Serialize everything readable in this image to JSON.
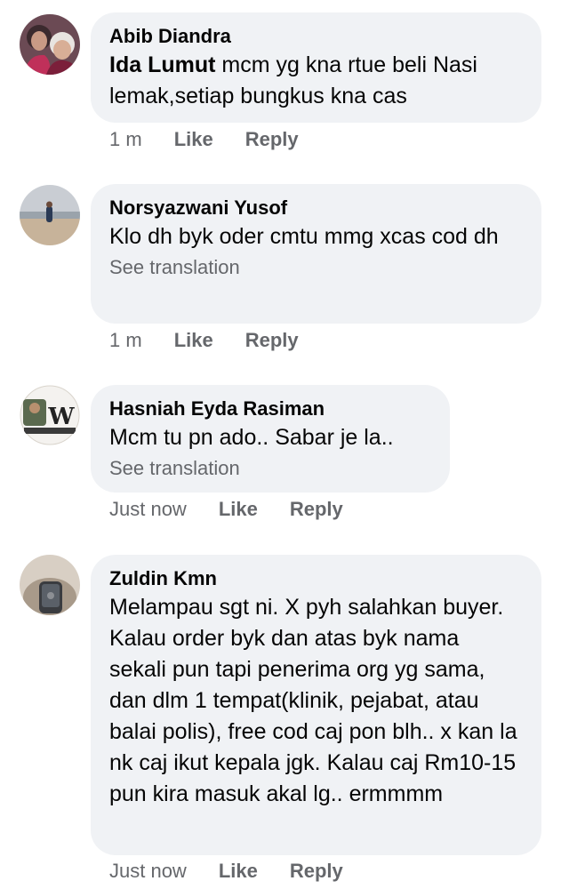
{
  "comments": [
    {
      "author": "Abib Diandra",
      "tagged": "Ida Lumut",
      "text": " mcm yg kna rtue beli Nasi lemak,setiap bungkus kna cas",
      "see_translation": "",
      "time": "1 m",
      "like": "Like",
      "reply": "Reply"
    },
    {
      "author": "Norsyazwani Yusof",
      "tagged": "",
      "text": "Klo dh byk oder cmtu mmg xcas cod dh",
      "see_translation": "See translation",
      "time": "1 m",
      "like": "Like",
      "reply": "Reply"
    },
    {
      "author": "Hasniah Eyda Rasiman",
      "tagged": "",
      "text": "Mcm tu pn ado.. Sabar je la..",
      "see_translation": "See translation",
      "time": "Just now",
      "like": "Like",
      "reply": "Reply"
    },
    {
      "author": "Zuldin Kmn",
      "tagged": "",
      "text": "Melampau sgt ni. X pyh salahkan buyer. Kalau order byk dan atas byk nama sekali pun tapi penerima org yg sama, dan dlm 1 tempat(klinik, pejabat, atau balai polis), free cod caj pon blh.. x kan la nk caj ikut kepala jgk. Kalau caj Rm10-15 pun kira masuk akal lg.. ermmmm",
      "see_translation": "",
      "time": "Just now",
      "like": "Like",
      "reply": "Reply"
    }
  ],
  "avatar_logo_text": "W"
}
